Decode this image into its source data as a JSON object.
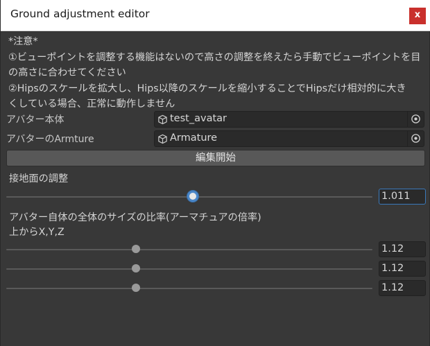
{
  "window": {
    "title": "Ground adjustment editor",
    "close_label": "x"
  },
  "notice": {
    "lines": [
      "*注意*",
      "①ビューポイントを調整する機能はないので高さの調整を終えたら手動でビューポイントを目",
      "の高さに合わせてください",
      "②Hipsのスケールを拡大し、Hips以降のスケールを縮小することでHipsだけ相対的に大き",
      "くしている場合、正常に動作しません"
    ]
  },
  "fields": {
    "avatar": {
      "label": "アバター本体",
      "value": "test_avatar"
    },
    "armature": {
      "label": "アバターのArmture",
      "value": "Armature"
    }
  },
  "edit_button": {
    "label": "編集開始"
  },
  "ground": {
    "label": "接地面の調整",
    "value": "1.011",
    "slider_fraction": 0.51
  },
  "scale": {
    "label_line1": "アバター自体の全体のサイズの比率(アーマチュアの倍率)",
    "label_line2": "上からX,Y,Z",
    "x": {
      "value": "1.12",
      "slider_fraction": 0.355
    },
    "y": {
      "value": "1.12",
      "slider_fraction": 0.355
    },
    "z": {
      "value": "1.12",
      "slider_fraction": 0.355
    }
  },
  "colors": {
    "background": "#383838",
    "close_button": "#c9302c",
    "focus_accent": "#4a86c8"
  },
  "icons": {
    "object": "cube-icon",
    "picker": "target-circle-icon"
  }
}
